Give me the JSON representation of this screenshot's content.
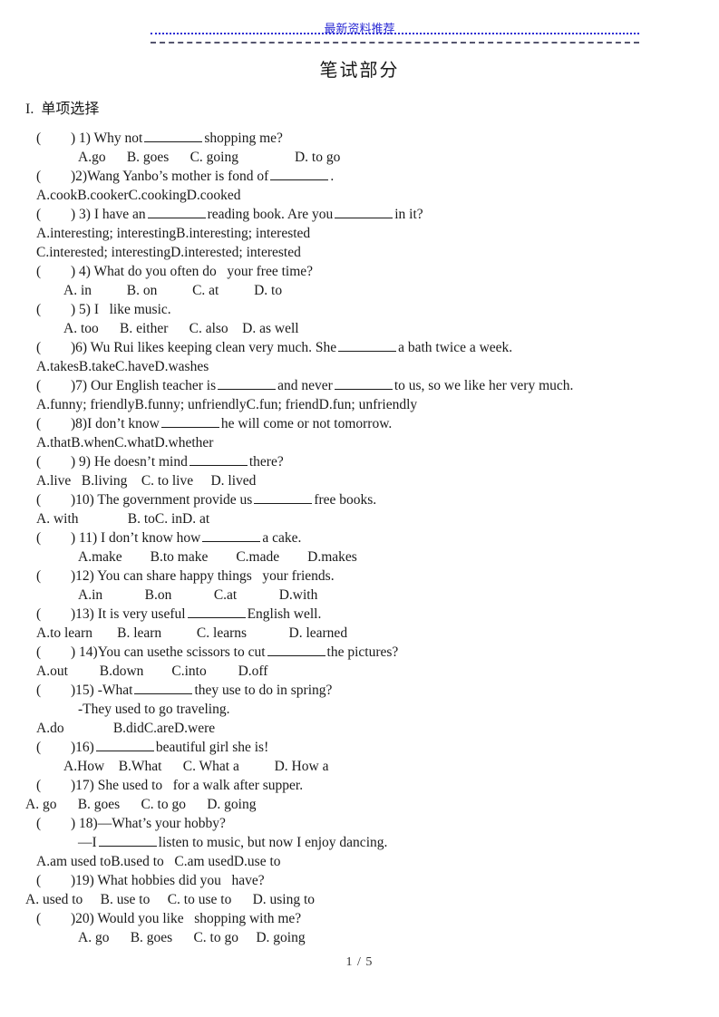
{
  "header": {
    "watermark": "最新资料推荐",
    "watermark_color": "#2b2bd4",
    "dotted_rule_color": "#2b2bd4",
    "dashed_rule_color": "#55556e"
  },
  "title": "笔试部分",
  "section": {
    "heading": "I.  单项选择"
  },
  "questions": [
    {
      "number": "1)",
      "stem_before": ") 1) Why not",
      "stem_after": "shopping me?",
      "blank": "md",
      "options_line": "A.go      B. goes      C. going                D. to go",
      "options_indent": "ind-4"
    },
    {
      "number": "2)",
      "stem_before": ")2)Wang Yanbo’s mother is fond of",
      "stem_after": ".",
      "blank": "md",
      "options_line": "A.cookB.cookerC.cookingD.cooked",
      "options_indent": "ind-1"
    },
    {
      "number": "3)",
      "stem_before": ") 3) I have an",
      "stem_mid": "reading book. Are you",
      "stem_after": "in it?",
      "blank": "md",
      "options_line": "A.interesting; interestingB.interesting; interested",
      "options_line2": "C.interested; interestingD.interested; interested",
      "options_indent": "ind-1"
    },
    {
      "number": "4)",
      "stem_before": ") 4) What do you often do   your free time?",
      "options_line": "A. in          B. on          C. at          D. to",
      "options_indent": "ind-3"
    },
    {
      "number": "5)",
      "stem_before": ") 5) I   like music.",
      "options_line": "A. too      B. either      C. also    D. as well",
      "options_indent": "ind-3"
    },
    {
      "number": "6)",
      "stem_before": ")6) Wu Rui likes keeping clean very much. She",
      "stem_after": "a bath twice a week.",
      "blank": "md",
      "options_line": "A.takesB.takeC.haveD.washes",
      "options_indent": "ind-1"
    },
    {
      "number": "7)",
      "stem_before": ")7) Our English teacher is",
      "stem_mid": "and never",
      "stem_after": "to us, so we like her very much.",
      "blank": "md",
      "options_line": "A.funny; friendlyB.funny; unfriendlyC.fun; friendD.fun; unfriendly",
      "options_indent": "ind-1"
    },
    {
      "number": "8)",
      "stem_before": ")8)I don’t know",
      "stem_after": "he will come or not tomorrow.",
      "blank": "md",
      "options_line": "A.thatB.whenC.whatD.whether",
      "options_indent": "ind-1"
    },
    {
      "number": "9)",
      "stem_before": ") 9) He doesn’t mind",
      "stem_after": "there?",
      "blank": "md",
      "options_line": "A.live   B.living    C. to live     D. lived",
      "options_indent": "ind-1"
    },
    {
      "number": "10)",
      "stem_before": ")10) The government provide us",
      "stem_after": "free books.",
      "blank": "md",
      "options_line": "A. with              B. toC. inD. at",
      "options_indent": "ind-1"
    },
    {
      "number": "11)",
      "stem_before": ") 11) I don’t know how",
      "stem_after": "a cake.",
      "blank": "md",
      "options_line": "A.make        B.to make        C.made        D.makes",
      "options_indent": "ind-4"
    },
    {
      "number": "12)",
      "stem_before": ")12) You can share happy things   your friends.",
      "options_line": "A.in            B.on            C.at            D.with",
      "options_indent": "ind-4"
    },
    {
      "number": "13)",
      "stem_before": ")13) It is very useful",
      "stem_after": "English well.",
      "blank": "md",
      "options_line": "A.to learn       B. learn          C. learns            D. learned",
      "options_indent": "ind-1"
    },
    {
      "number": "14)",
      "stem_before": ") 14)You can usethe scissors to cut",
      "stem_after": "the pictures?",
      "blank": "md",
      "options_line": "A.out         B.down        C.into         D.off",
      "options_indent": "ind-1"
    },
    {
      "number": "15)",
      "stem_before": ")15) -What",
      "stem_after": "they use to do in spring?",
      "blank": "md",
      "extra_line": "-They used to go traveling.",
      "extra_indent": "ind-4",
      "options_line": "A.do              B.didC.areD.were",
      "options_indent": "ind-1"
    },
    {
      "number": "16)",
      "stem_before": ")16)",
      "stem_after": "beautiful girl she is!",
      "blank": "md",
      "options_line": "A.How    B.What      C. What a          D. How a",
      "options_indent": "ind-3"
    },
    {
      "number": "17)",
      "stem_before": ")17) She used to   for a walk after supper.",
      "options_line": "A. go      B. goes      C. to go      D. going",
      "options_indent": "ind-0"
    },
    {
      "number": "18)",
      "stem_before": ") 18)—What’s your hobby?",
      "extra_line_before": "—I",
      "extra_line_after": "listen to music, but now I enjoy dancing.",
      "extra_blank": "md",
      "extra_indent": "ind-4",
      "options_line": "A.am used toB.used to   C.am usedD.use to",
      "options_indent": "ind-1"
    },
    {
      "number": "19)",
      "stem_before": ")19) What hobbies did you   have?",
      "options_line": "A. used to     B. use to     C. to use to      D. using to",
      "options_indent": "ind-0"
    },
    {
      "number": "20)",
      "stem_before": ")20) Would you like   shopping with me?",
      "options_line": "A. go      B. goes      C. to go     D. going",
      "options_indent": "ind-4"
    }
  ],
  "footer": {
    "page_number": "1 / 5"
  }
}
